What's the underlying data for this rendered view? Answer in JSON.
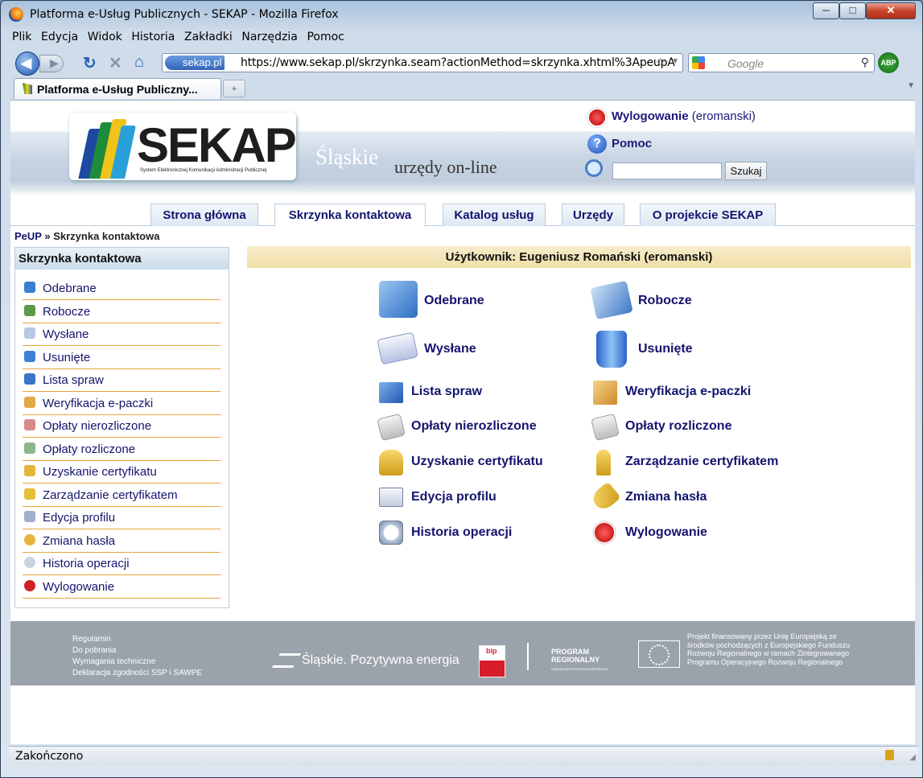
{
  "window": {
    "title": "Platforma e-Usług Publicznych - SEKAP - Mozilla Firefox",
    "min": "─",
    "max": "□",
    "close": "✕"
  },
  "menu": [
    "Plik",
    "Edycja",
    "Widok",
    "Historia",
    "Zakładki",
    "Narzędzia",
    "Pomoc"
  ],
  "nav": {
    "site": "sekap.pl",
    "url": "https://www.sekap.pl/skrzynka.seam?actionMethod=skrzynka.xhtml%3ApeupA",
    "search_placeholder": "Google",
    "addon": "ABP"
  },
  "tabs": [
    {
      "label": "Platforma e-Usług Publiczny..."
    }
  ],
  "header": {
    "logo_word": "SEKAP",
    "logo_sub": "System Elektronicznej Komunikacji Administracji Publicznej",
    "slogan1": "Śląskie",
    "slogan2": "urzędy on-line",
    "logout": "Wylogowanie",
    "logout_user": "(eromanski)",
    "help": "Pomoc",
    "search_button": "Szukaj"
  },
  "navtabs": [
    "Strona główna",
    "Skrzynka kontaktowa",
    "Katalog usług",
    "Urzędy",
    "O projekcie SEKAP"
  ],
  "breadcrumb": {
    "home": "PeUP",
    "sep": "»",
    "current": "Skrzynka kontaktowa"
  },
  "sidebar": {
    "title": "Skrzynka kontaktowa",
    "items": [
      "Odebrane",
      "Robocze",
      "Wysłane",
      "Usunięte",
      "Lista spraw",
      "Weryfikacja e-paczki",
      "Opłaty nierozliczone",
      "Opłaty rozliczone",
      "Uzyskanie certyfikatu",
      "Zarządzanie certyfikatem",
      "Edycja profilu",
      "Zmiana hasła",
      "Historia operacji",
      "Wylogowanie"
    ]
  },
  "main": {
    "user_bar": "Użytkownik: Eugeniusz Romański (eromanski)",
    "items": [
      "Odebrane",
      "Robocze",
      "Wysłane",
      "Usunięte",
      "Lista spraw",
      "Weryfikacja e-paczki",
      "Opłaty nierozliczone",
      "Opłaty rozliczone",
      "Uzyskanie certyfikatu",
      "Zarządzanie certyfikatem",
      "Edycja profilu",
      "Zmiana hasła",
      "Historia operacji",
      "Wylogowanie"
    ]
  },
  "footer": {
    "links": [
      "Regulamin",
      "Do pobrania",
      "Wymagania techniczne",
      "Deklaracja zgodności SSP i SAWPE"
    ],
    "slaskie": "Śląskie.",
    "slaskie2": "Pozytywna energia",
    "bip": "bip",
    "program": "PROGRAM REGIONALNY",
    "program_sub": "NARODOWA STRATEGIA SPÓJNOŚCI",
    "eu_text": "Projekt finansowany przez Unię Europejską ze środków pochodzących z Europejskiego Funduszu Rozwoju Regionalnego w ramach Zintegrowanego Programu Operacyjnego Rozwoju Regionalnego"
  },
  "status": "Zakończono"
}
